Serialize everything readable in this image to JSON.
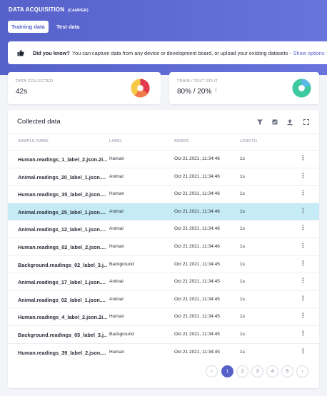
{
  "header": {
    "title": "DATA ACQUISITION",
    "project": "(CAMPER)",
    "tabs": [
      {
        "label": "Training data",
        "active": true
      },
      {
        "label": "Test data",
        "active": false
      }
    ]
  },
  "banner": {
    "icon": "thumbs-up-icon",
    "bold": "Did you know?",
    "text": "You can capture data from any device or development board, or upload your existing datasets -",
    "link": "Show options"
  },
  "stats": {
    "collected_label": "DATA COLLECTED",
    "collected_value": "42s",
    "split_label": "TRAIN / TEST SPLIT",
    "split_value": "80% / 20%",
    "help_icon": "question-circle-icon"
  },
  "colors": {
    "accent": "#5661c9",
    "selected_row": "#c5ebf6",
    "class_yellow": "#f7c948",
    "class_orange": "#f07b4a",
    "class_red": "#e23b4e",
    "train": "#3ec9a0",
    "test": "#5cb8e6"
  },
  "table": {
    "title": "Collected data",
    "tools": [
      "filter-icon",
      "check-square-icon",
      "upload-icon",
      "expand-icon"
    ],
    "columns": [
      "SAMPLE NAME",
      "LABEL",
      "ADDED",
      "LENGTH"
    ],
    "rows": [
      {
        "name": "Human.readings_1_label_2.json.2i...",
        "label": "Human",
        "added": "Oct 21 2021, 11:34:46",
        "length": "1s",
        "selected": false
      },
      {
        "name": "Animal.readings_20_label_1.json....",
        "label": "Animal",
        "added": "Oct 21 2021, 11:34:46",
        "length": "1s",
        "selected": false
      },
      {
        "name": "Human.readings_35_label_2.json....",
        "label": "Human",
        "added": "Oct 21 2021, 11:34:46",
        "length": "1s",
        "selected": false
      },
      {
        "name": "Animal.readings_25_label_1.json....",
        "label": "Animal",
        "added": "Oct 21 2021, 11:34:46",
        "length": "1s",
        "selected": true
      },
      {
        "name": "Animal.readings_12_label_1.json....",
        "label": "Animal",
        "added": "Oct 21 2021, 11:34:46",
        "length": "1s",
        "selected": false
      },
      {
        "name": "Human.readings_02_label_2.json....",
        "label": "Human",
        "added": "Oct 21 2021, 11:34:46",
        "length": "1s",
        "selected": false
      },
      {
        "name": "Background.readings_02_label_3.j...",
        "label": "Background",
        "added": "Oct 21 2021, 11:34:45",
        "length": "1s",
        "selected": false
      },
      {
        "name": "Animal.readings_17_label_1.json....",
        "label": "Animal",
        "added": "Oct 21 2021, 11:34:45",
        "length": "1s",
        "selected": false
      },
      {
        "name": "Animal.readings_02_label_1.json....",
        "label": "Animal",
        "added": "Oct 21 2021, 11:34:45",
        "length": "1s",
        "selected": false
      },
      {
        "name": "Human.readings_4_label_2.json.2i...",
        "label": "Human",
        "added": "Oct 21 2021, 11:34:45",
        "length": "1s",
        "selected": false
      },
      {
        "name": "Background.readings_05_label_3.j...",
        "label": "Background",
        "added": "Oct 21 2021, 11:34:45",
        "length": "1s",
        "selected": false
      },
      {
        "name": "Human.readings_39_label_2.json....",
        "label": "Human",
        "added": "Oct 21 2021, 11:34:45",
        "length": "1s",
        "selected": false
      }
    ],
    "more_icon": "more-vertical-icon"
  },
  "pagination": {
    "prev_icon": "chevron-left-icon",
    "next_icon": "chevron-right-icon",
    "prev_glyph": "‹",
    "next_glyph": "›",
    "pages": [
      "1",
      "2",
      "3",
      "4",
      "5"
    ],
    "current": "1"
  }
}
